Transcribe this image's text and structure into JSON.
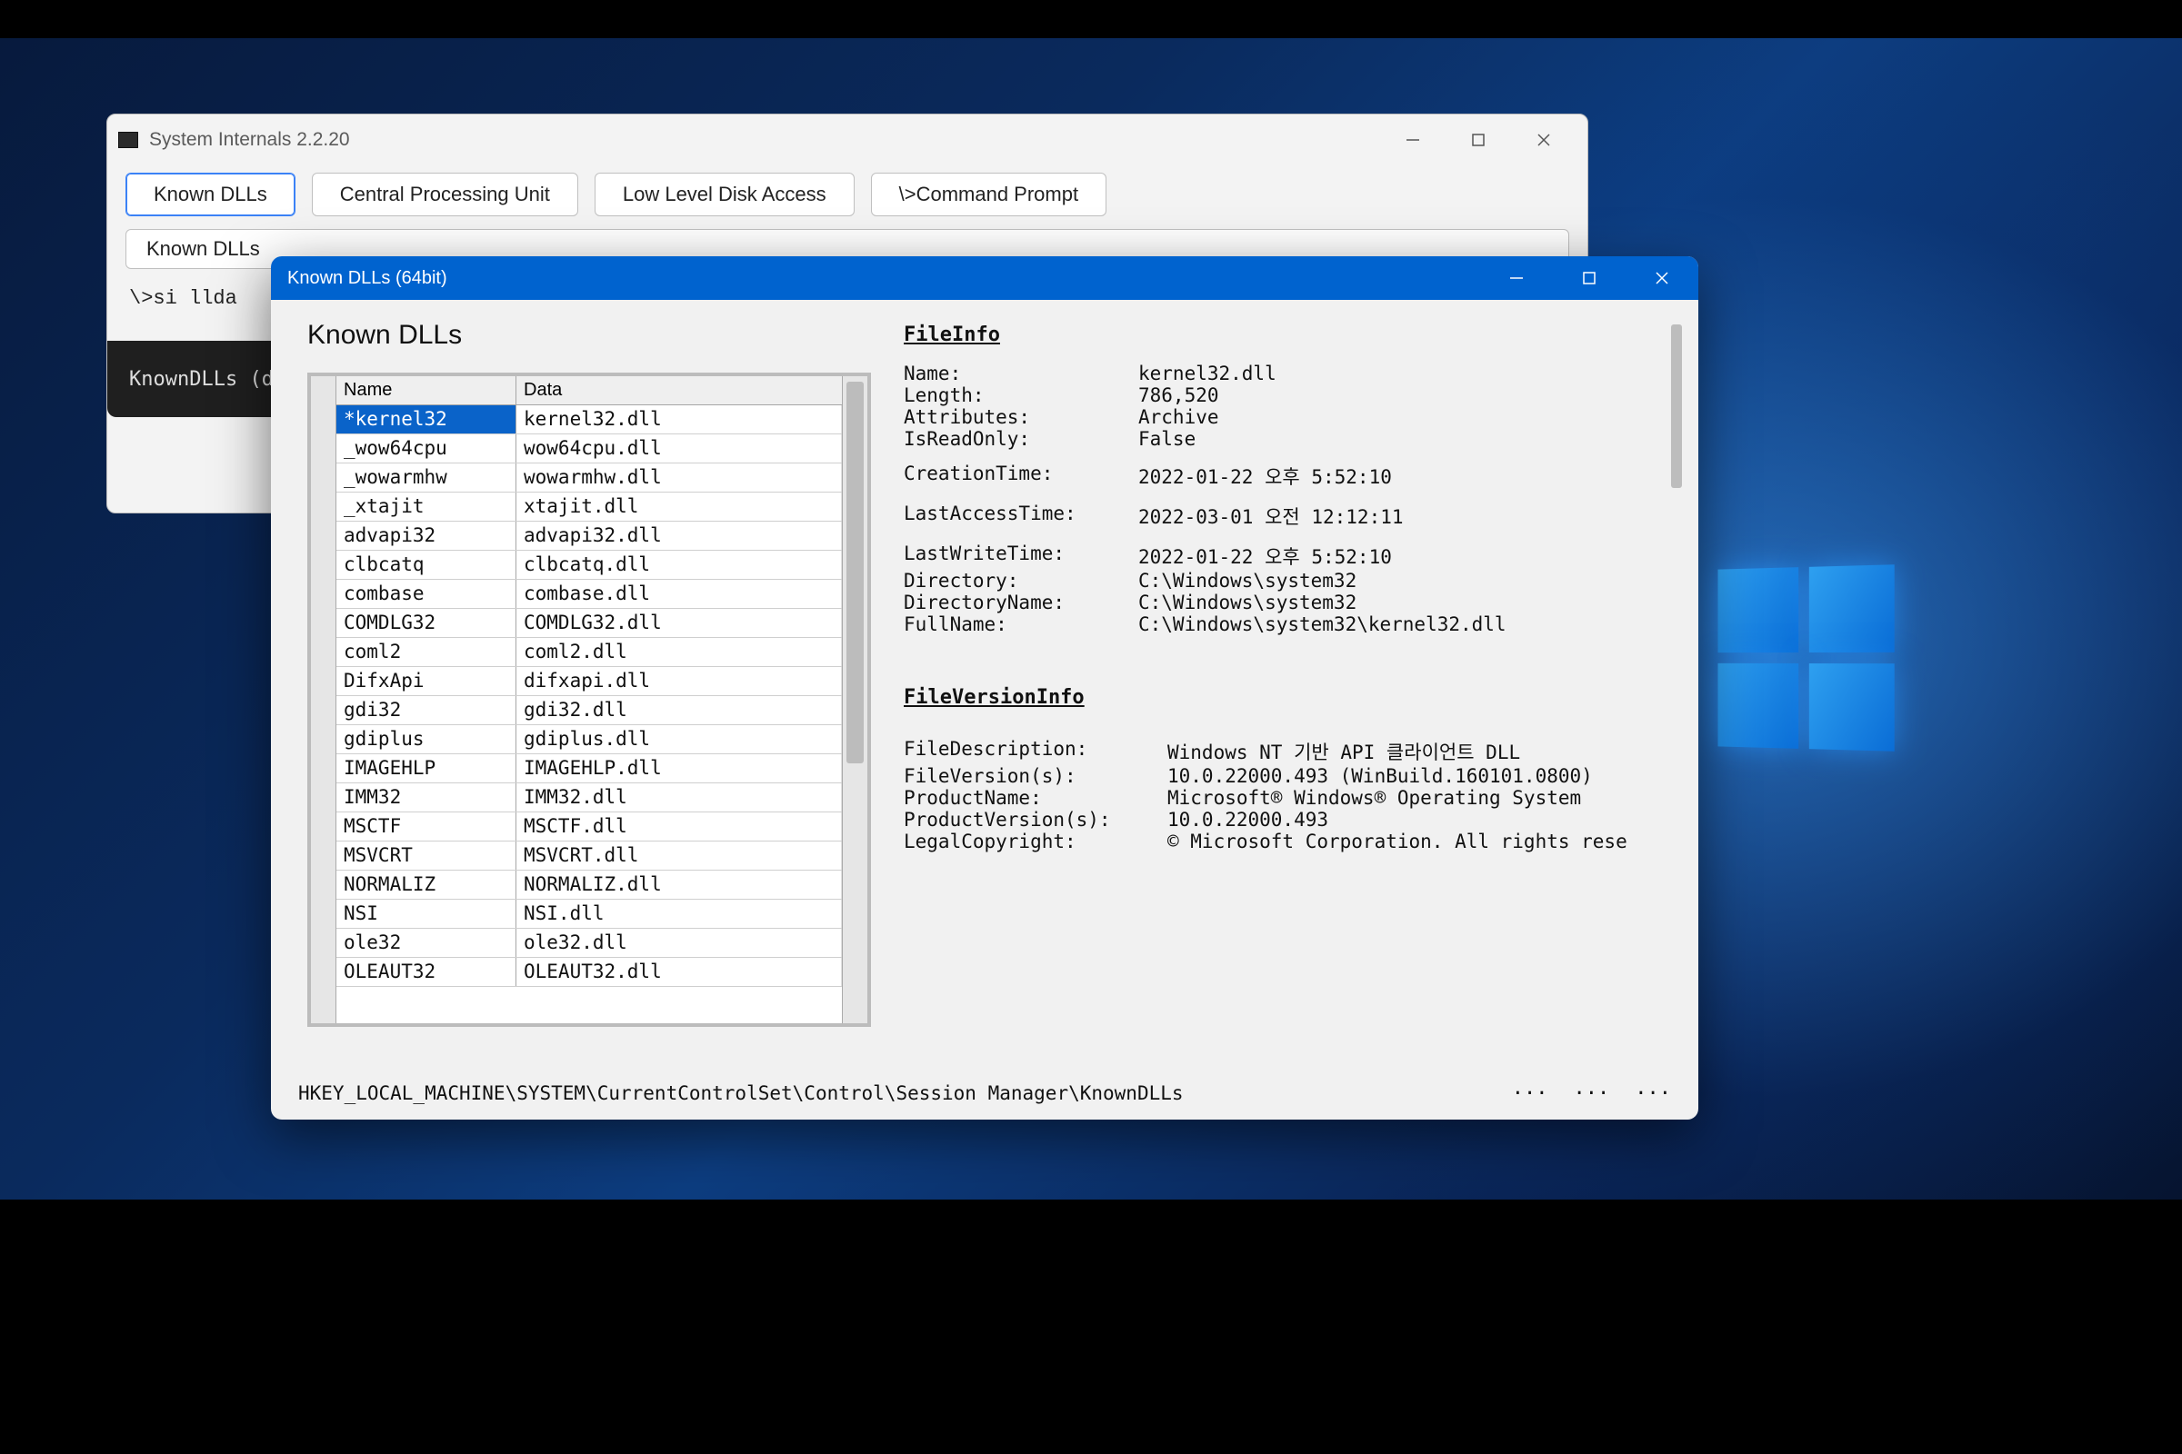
{
  "back": {
    "title": "System Internals 2.2.20",
    "buttons": [
      "Known DLLs",
      "Central Processing Unit",
      "Low Level Disk Access",
      "\\>Command Prompt"
    ],
    "sub_button": "Known DLLs",
    "prompt": "\\>si llda",
    "dark_text": "KnownDLLs (d"
  },
  "front": {
    "title": "Known DLLs (64bit)",
    "heading": "Known DLLs",
    "columns": [
      "Name",
      "Data"
    ],
    "rows": [
      {
        "name": "*kernel32",
        "data": "kernel32.dll",
        "sel": true
      },
      {
        "name": "_wow64cpu",
        "data": "wow64cpu.dll"
      },
      {
        "name": "_wowarmhw",
        "data": "wowarmhw.dll"
      },
      {
        "name": "_xtajit",
        "data": "xtajit.dll"
      },
      {
        "name": "advapi32",
        "data": "advapi32.dll"
      },
      {
        "name": "clbcatq",
        "data": "clbcatq.dll"
      },
      {
        "name": "combase",
        "data": "combase.dll"
      },
      {
        "name": "COMDLG32",
        "data": "COMDLG32.dll"
      },
      {
        "name": "coml2",
        "data": "coml2.dll"
      },
      {
        "name": "DifxApi",
        "data": "difxapi.dll"
      },
      {
        "name": "gdi32",
        "data": "gdi32.dll"
      },
      {
        "name": "gdiplus",
        "data": "gdiplus.dll"
      },
      {
        "name": "IMAGEHLP",
        "data": "IMAGEHLP.dll"
      },
      {
        "name": "IMM32",
        "data": "IMM32.dll"
      },
      {
        "name": "MSCTF",
        "data": "MSCTF.dll"
      },
      {
        "name": "MSVCRT",
        "data": "MSVCRT.dll"
      },
      {
        "name": "NORMALIZ",
        "data": "NORMALIZ.dll"
      },
      {
        "name": "NSI",
        "data": "NSI.dll"
      },
      {
        "name": "ole32",
        "data": "ole32.dll"
      },
      {
        "name": "OLEAUT32",
        "data": "OLEAUT32.dll"
      }
    ],
    "fileinfo_h": "FileInfo",
    "fileinfo": [
      {
        "k": "Name:",
        "v": "kernel32.dll"
      },
      {
        "k": "Length:",
        "v": "786,520"
      },
      {
        "k": "Attributes:",
        "v": "Archive"
      },
      {
        "k": "IsReadOnly:",
        "v": "False"
      }
    ],
    "fileinfo2": [
      {
        "k": "CreationTime:",
        "v": "2022-01-22 오후 5:52:10"
      }
    ],
    "fileinfo3": [
      {
        "k": "LastAccessTime:",
        "v": "2022-03-01 오전 12:12:11"
      }
    ],
    "fileinfo4": [
      {
        "k": "LastWriteTime:",
        "v": "2022-01-22 오후 5:52:10"
      },
      {
        "k": "Directory:",
        "v": "C:\\Windows\\system32"
      },
      {
        "k": "DirectoryName:",
        "v": "C:\\Windows\\system32"
      },
      {
        "k": "FullName:",
        "v": "C:\\Windows\\system32\\kernel32.dll"
      }
    ],
    "fvi_h": "FileVersionInfo",
    "fvi": [
      {
        "k": "FileDescription:",
        "v": "Windows NT 기반 API 클라이언트 DLL"
      },
      {
        "k": "FileVersion(s):",
        "v": "10.0.22000.493 (WinBuild.160101.0800)"
      },
      {
        "k": "ProductName:",
        "v": "Microsoft® Windows® Operating System"
      },
      {
        "k": "ProductVersion(s):",
        "v": "10.0.22000.493"
      },
      {
        "k": "LegalCopyright:",
        "v": "© Microsoft Corporation. All rights rese"
      }
    ],
    "status": "HKEY_LOCAL_MACHINE\\SYSTEM\\CurrentControlSet\\Control\\Session Manager\\KnownDLLs",
    "dots": [
      "···",
      "···",
      "···"
    ]
  }
}
